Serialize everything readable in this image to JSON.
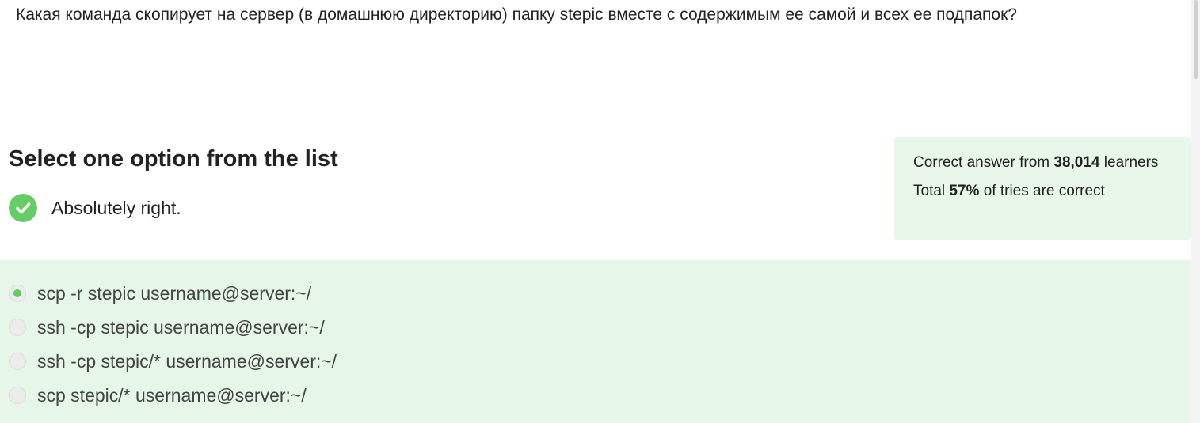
{
  "question": {
    "text": "Какая команда скопирует на сервер (в домашнюю директорию) папку stepic вместе с содержимым ее самой и всех ее подпапок?"
  },
  "section": {
    "title": "Select one option from the list"
  },
  "feedback": {
    "icon": "check-circle-icon",
    "text": "Absolutely right."
  },
  "stats": {
    "correct_prefix": "Correct answer from ",
    "learners_count": "38,014",
    "learners_suffix": " learners",
    "total_prefix": "Total ",
    "percent": "57%",
    "total_suffix": " of tries are correct"
  },
  "options": [
    {
      "label": "scp -r stepic username@server:~/",
      "selected": true
    },
    {
      "label": "ssh -cp stepic username@server:~/",
      "selected": false
    },
    {
      "label": "ssh -cp stepic/* username@server:~/",
      "selected": false
    },
    {
      "label": "scp stepic/* username@server:~/",
      "selected": false
    }
  ],
  "colors": {
    "success": "#66cc66",
    "panel_bg": "#e6f6e8"
  }
}
